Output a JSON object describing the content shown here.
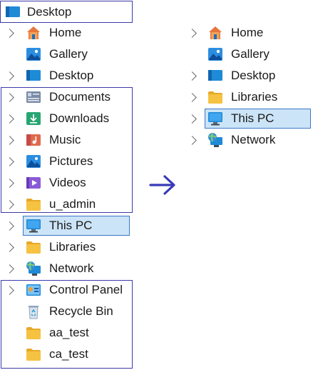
{
  "left_tree": {
    "header": {
      "label": "Desktop",
      "icon": "desktop-icon"
    },
    "items": [
      {
        "label": "Home",
        "icon": "home-icon",
        "chevron": true
      },
      {
        "label": "Gallery",
        "icon": "gallery-icon",
        "chevron": false
      },
      {
        "label": "Desktop",
        "icon": "desktop-icon",
        "chevron": true
      },
      {
        "label": "Documents",
        "icon": "documents-icon",
        "chevron": true
      },
      {
        "label": "Downloads",
        "icon": "downloads-icon",
        "chevron": true
      },
      {
        "label": "Music",
        "icon": "music-icon",
        "chevron": true
      },
      {
        "label": "Pictures",
        "icon": "pictures-icon",
        "chevron": true
      },
      {
        "label": "Videos",
        "icon": "videos-icon",
        "chevron": true
      },
      {
        "label": "u_admin",
        "icon": "folder-icon",
        "chevron": true
      },
      {
        "label": "This PC",
        "icon": "this-pc-icon",
        "chevron": true,
        "selected": true
      },
      {
        "label": "Libraries",
        "icon": "folder-icon",
        "chevron": true
      },
      {
        "label": "Network",
        "icon": "network-icon",
        "chevron": true
      },
      {
        "label": "Control Panel",
        "icon": "control-panel-icon",
        "chevron": true
      },
      {
        "label": "Recycle Bin",
        "icon": "recycle-bin-icon",
        "chevron": false
      },
      {
        "label": "aa_test",
        "icon": "folder-icon",
        "chevron": false
      },
      {
        "label": "ca_test",
        "icon": "folder-icon",
        "chevron": false
      }
    ]
  },
  "arrow": {
    "icon": "arrow-right-icon",
    "color": "#3a3ab8"
  },
  "right_tree": {
    "items": [
      {
        "label": "Home",
        "icon": "home-icon",
        "chevron": true
      },
      {
        "label": "Gallery",
        "icon": "gallery-icon",
        "chevron": false
      },
      {
        "label": "Desktop",
        "icon": "desktop-icon",
        "chevron": true
      },
      {
        "label": "Libraries",
        "icon": "folder-icon",
        "chevron": true
      },
      {
        "label": "This PC",
        "icon": "this-pc-icon",
        "chevron": true,
        "selected": true
      },
      {
        "label": "Network",
        "icon": "network-icon",
        "chevron": true
      }
    ]
  },
  "colors": {
    "selection_bg": "#cce4f7",
    "selection_border": "#3d77c8",
    "group_border": "#3a3aa8",
    "folder": "#f5c242"
  }
}
